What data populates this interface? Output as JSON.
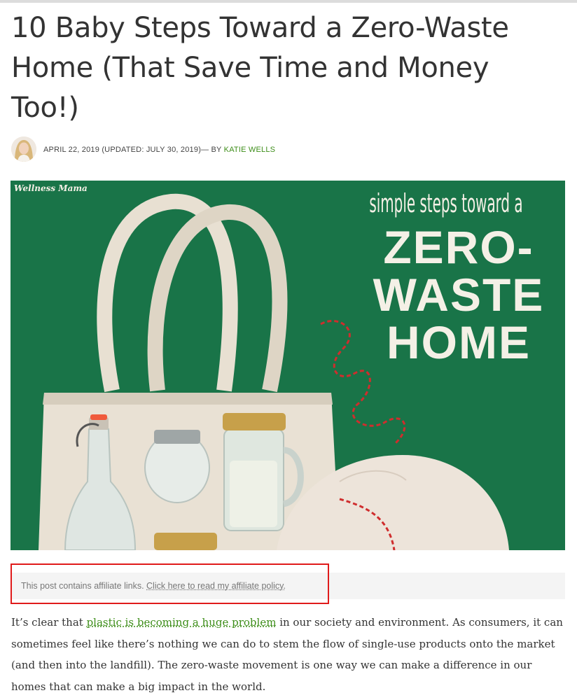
{
  "article": {
    "title": "10 Baby Steps Toward a Zero-Waste Home (That Save Time and Money Too!)",
    "date_text": "APRIL 22, 2019 (UPDATED: JULY 30, 2019)— BY ",
    "author": "KATIE WELLS"
  },
  "hero": {
    "brand_watermark": "Wellness Mama",
    "line1": "simple steps toward a",
    "line2": "ZERO-",
    "line3": "WASTE",
    "line4": "HOME"
  },
  "affiliate": {
    "text": "This post contains affiliate links. ",
    "link": "Click here to read my affiliate policy."
  },
  "body": {
    "p1_before": "It’s clear that ",
    "p1_link": "plastic is becoming a huge problem",
    "p1_after": " in our society and environment. As consumers, it can sometimes feel like there’s nothing we can do to stem the flow of single-use products onto the market (and then into the landfill). The zero-waste movement is one way we can make a difference in our homes that can make a big impact in the world."
  },
  "colors": {
    "accent_green": "#3e8e1a",
    "hero_background": "#1b7a4c",
    "highlight_box": "#e01b1b"
  }
}
